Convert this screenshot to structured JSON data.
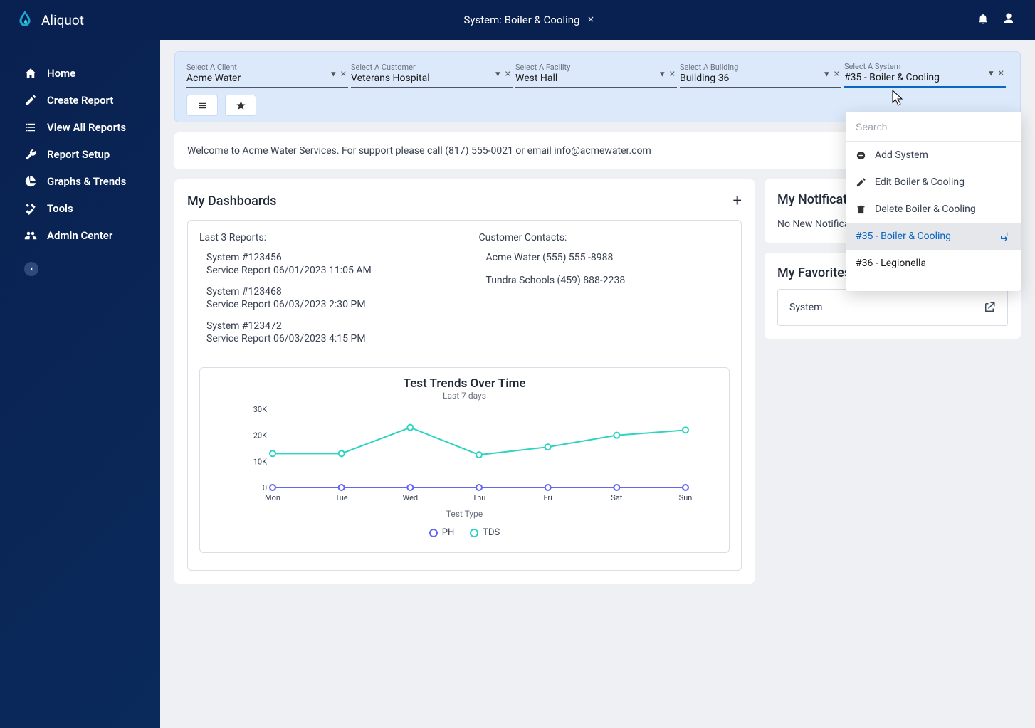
{
  "app_name": "Aliquot",
  "header": {
    "system_label": "System: Boiler & Cooling"
  },
  "sidebar": {
    "items": [
      {
        "label": "Home"
      },
      {
        "label": "Create Report"
      },
      {
        "label": "View All Reports"
      },
      {
        "label": "Report Setup"
      },
      {
        "label": "Graphs & Trends"
      },
      {
        "label": "Tools"
      },
      {
        "label": "Admin Center"
      }
    ]
  },
  "filters": [
    {
      "label": "Select A Client",
      "value": "Acme Water"
    },
    {
      "label": "Select A Customer",
      "value": "Veterans Hospital"
    },
    {
      "label": "Select A Facility",
      "value": "West Hall"
    },
    {
      "label": "Select A Building",
      "value": "Building 36"
    },
    {
      "label": "Select A System",
      "value": "#35 - Boiler & Cooling",
      "active": true
    }
  ],
  "welcome_text": "Welcome to Acme Water Services. For support please call (817) 555-0021 or email info@acmewater.com",
  "dashboards": {
    "title": "My Dashboards",
    "last_reports_title": "Last 3 Reports:",
    "contacts_title": "Customer Contacts:",
    "reports": [
      {
        "line1": "System #123456",
        "line2": "Service Report 06/01/2023 11:05 AM"
      },
      {
        "line1": "System #123468",
        "line2": "Service Report 06/03/2023 2:30 PM"
      },
      {
        "line1": "System #123472",
        "line2": "Service Report 06/03/2023 4:15 PM"
      }
    ],
    "contacts": [
      "Acme Water (555) 555 -8988",
      "Tundra Schools (459) 888-2238"
    ]
  },
  "chart_data": {
    "type": "line",
    "title": "Test Trends Over Time",
    "subtitle": "Last 7 days",
    "legend_title": "Test Type",
    "x": [
      "Mon",
      "Tue",
      "Wed",
      "Thu",
      "Fri",
      "Sat",
      "Sun"
    ],
    "ylabel": "",
    "xlabel": "",
    "y_ticks": [
      "0",
      "10K",
      "20K",
      "30K"
    ],
    "ylim": [
      0,
      30000
    ],
    "series": [
      {
        "name": "PH",
        "color": "#6366f1",
        "values": [
          0,
          0,
          0,
          0,
          0,
          0,
          0
        ]
      },
      {
        "name": "TDS",
        "color": "#2dd4bf",
        "values": [
          13000,
          13000,
          23000,
          12500,
          15500,
          20000,
          22000
        ]
      }
    ]
  },
  "notifications": {
    "title": "My Notifications",
    "empty_text": "No New Notifications"
  },
  "favorites": {
    "title": "My Favorites",
    "item": "System"
  },
  "dropdown": {
    "search_placeholder": "Search",
    "add_label": "Add System",
    "edit_label": "Edit Boiler & Cooling",
    "delete_label": "Delete Boiler & Cooling",
    "options": [
      {
        "label": "#35 - Boiler & Cooling",
        "selected": true
      },
      {
        "label": "#36 - Legionella",
        "selected": false
      }
    ]
  }
}
